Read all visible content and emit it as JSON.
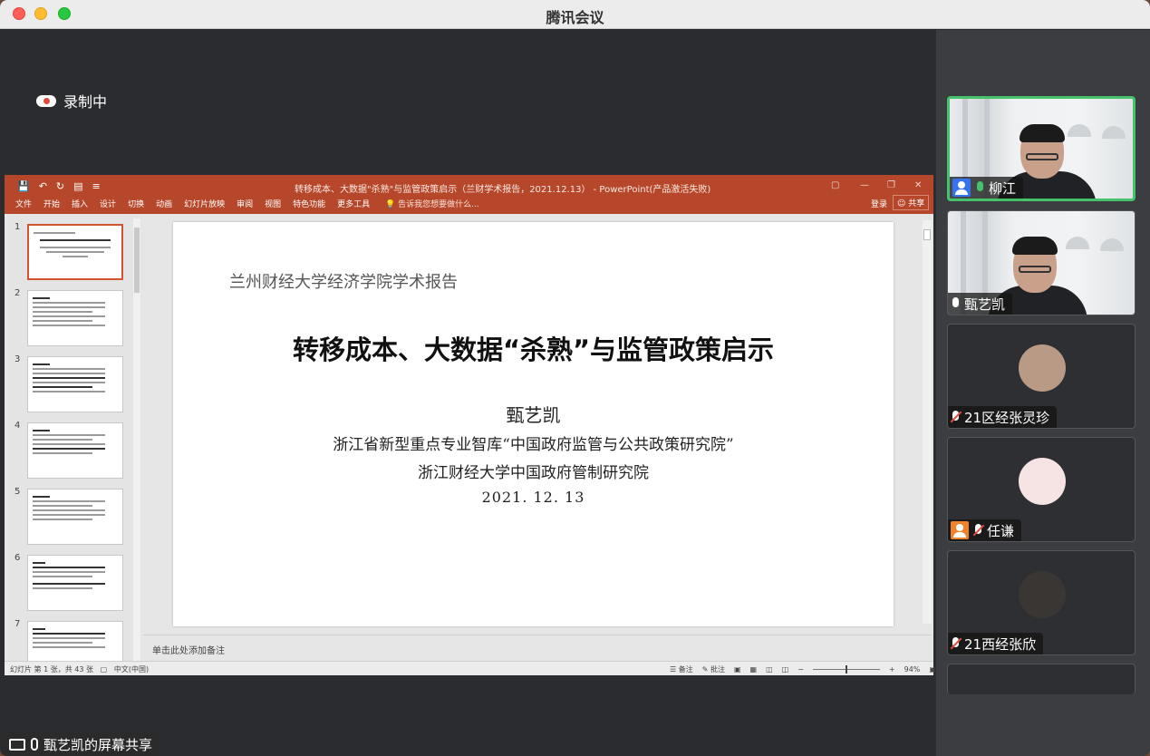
{
  "window": {
    "title": "腾讯会议"
  },
  "recording": {
    "label": "录制中"
  },
  "screen_share": {
    "label": "甄艺凯的屏幕共享"
  },
  "ppt": {
    "title_bar": "转移成本、大数据\"杀熟\"与监管政策启示（兰财学术报告，2021.12.13） - PowerPoint(产品激活失败)",
    "tabs": [
      "文件",
      "开始",
      "插入",
      "设计",
      "切换",
      "动画",
      "幻灯片放映",
      "审阅",
      "视图",
      "特色功能",
      "更多工具"
    ],
    "tell_me": "告诉我您想要做什么...",
    "login": "登录",
    "share": "共享",
    "thumbnail_numbers": [
      "1",
      "2",
      "3",
      "4",
      "5",
      "6",
      "7"
    ],
    "notes_placeholder": "单击此处添加备注",
    "status_left": "幻灯片 第 1 张，共 43 张",
    "status_lang": "中文(中国)",
    "notes_btn": "备注",
    "comments_btn": "批注",
    "zoom": "94%"
  },
  "slide": {
    "school": "兰州财经大学经济学院学术报告",
    "title": "转移成本、大数据“杀熟”与监管政策启示",
    "author": "甄艺凯",
    "institution1": "浙江省新型重点专业智库“中国政府监管与公共政策研究院”",
    "institution2": "浙江财经大学中国政府管制研究院",
    "date": "2021. 12. 13"
  },
  "participants": [
    {
      "name": "柳江",
      "mic": "on",
      "badge": "blue",
      "video": true
    },
    {
      "name": "甄艺凯",
      "mic": "on",
      "badge": "none",
      "video": true
    },
    {
      "name": "21区经张灵珍",
      "mic": "muted",
      "badge": "none",
      "video": false
    },
    {
      "name": "任谦",
      "mic": "muted",
      "badge": "orange",
      "video": false
    },
    {
      "name": "21西经张欣",
      "mic": "muted",
      "badge": "none",
      "video": false
    }
  ],
  "colors": {
    "ppt_accent": "#b7472a",
    "active_speaker": "#45c26b",
    "muted": "#e64a3b"
  }
}
